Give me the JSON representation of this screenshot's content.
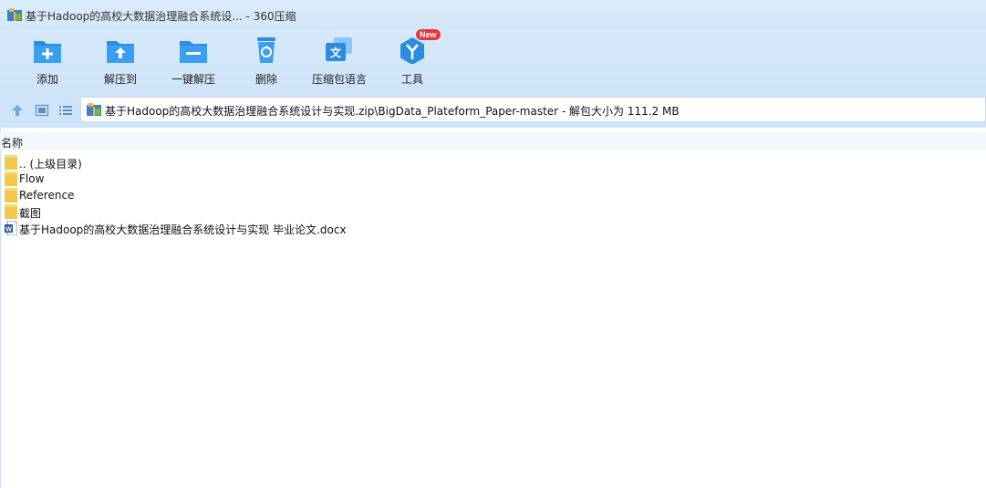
{
  "window": {
    "title": "基于Hadoop的高校大数据治理融合系统设... - 360压缩"
  },
  "toolbar": {
    "add": "添加",
    "extract_to": "解压到",
    "one_click": "一键解压",
    "delete": "删除",
    "language": "压缩包语言",
    "tools": "工具",
    "tools_badge": "New"
  },
  "pathbar": {
    "path": "基于Hadoop的高校大数据治理融合系统设计与实现.zip\\BigData_Plateform_Paper-master - 解包大小为 111.2 MB"
  },
  "list": {
    "column_name": "名称",
    "items": [
      {
        "name": ".. (上级目录)",
        "type": "folder"
      },
      {
        "name": "Flow",
        "type": "folder"
      },
      {
        "name": "Reference",
        "type": "folder"
      },
      {
        "name": "截图",
        "type": "folder"
      },
      {
        "name": "基于Hadoop的高校大数据治理融合系统设计与实现 毕业论文.docx",
        "type": "word-doc"
      }
    ]
  },
  "colors": {
    "accent": "#2a8de0",
    "titlebar": "#d9ebfb",
    "folder": "#f5c64c",
    "badge": "#e5383b"
  }
}
